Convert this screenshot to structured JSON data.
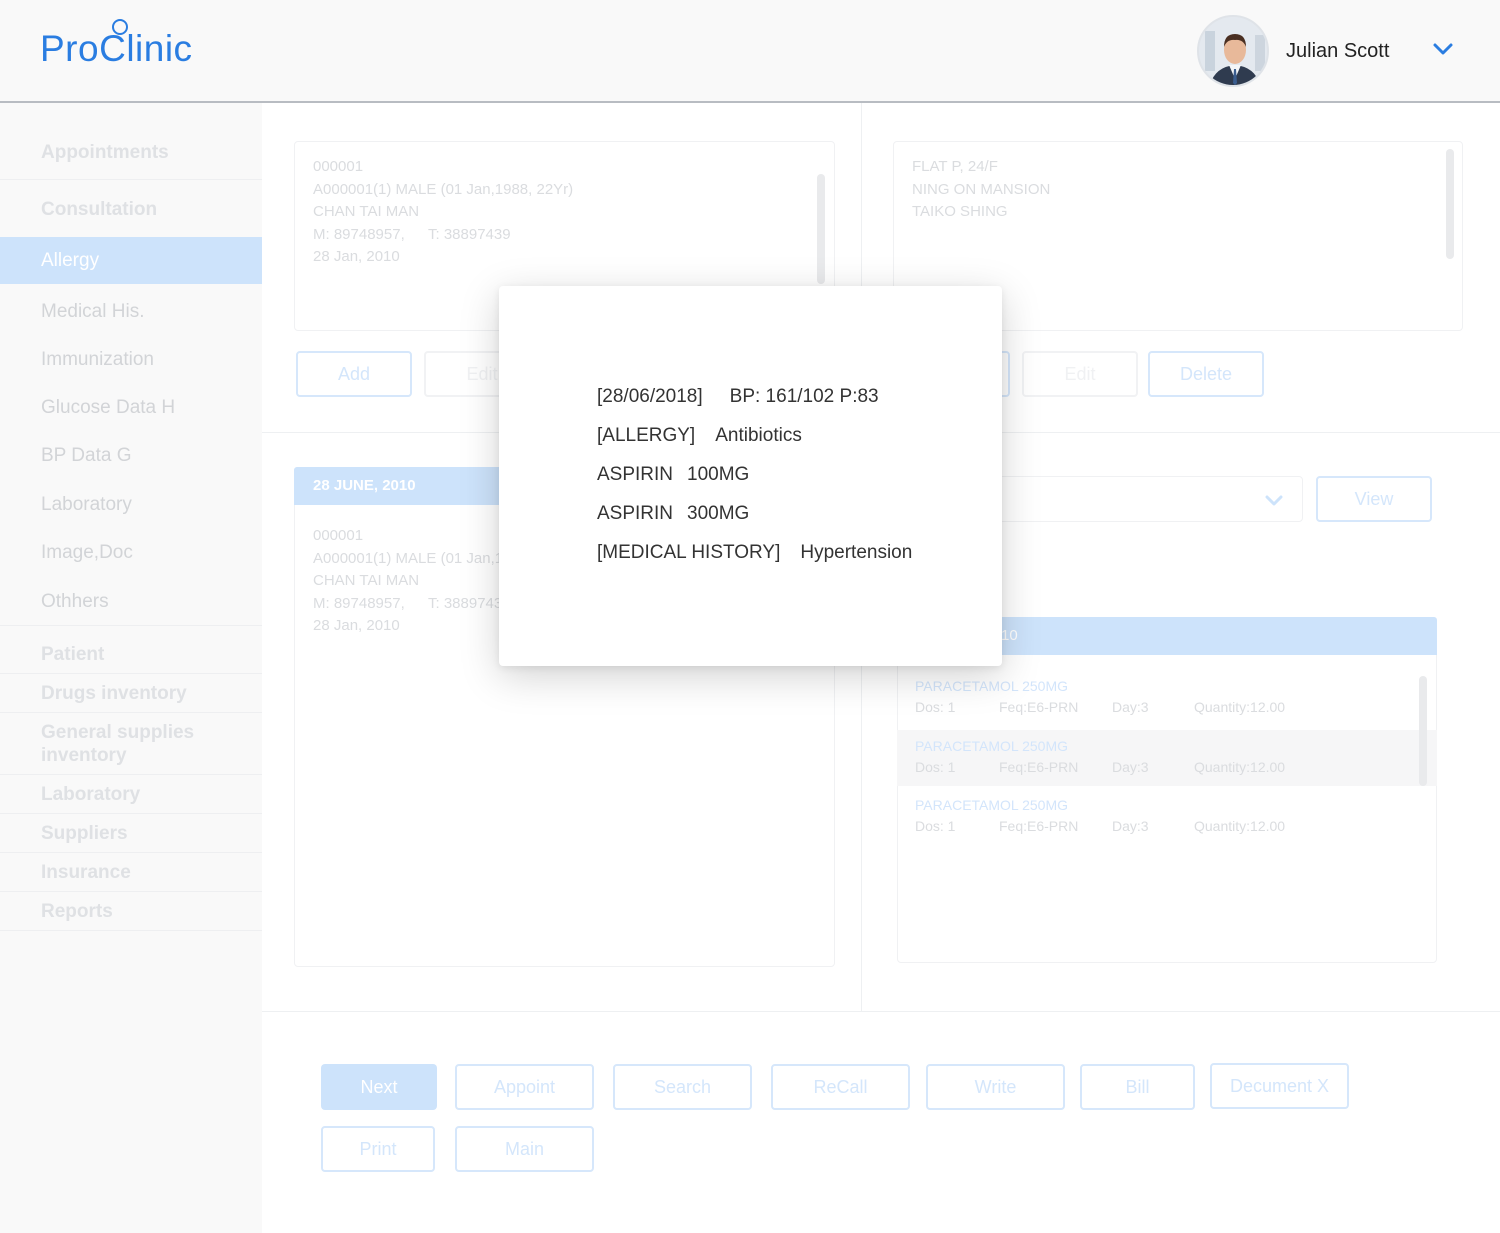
{
  "header": {
    "logo_left": "Pro",
    "logo_right": "linic",
    "user_name": "Julian Scott"
  },
  "sidebar": {
    "items": [
      {
        "label": "Appointments"
      },
      {
        "label": "Consultation"
      },
      {
        "label": "Allergy"
      },
      {
        "label": "Medical His."
      },
      {
        "label": "Immunization"
      },
      {
        "label": "Glucose Data H"
      },
      {
        "label": "BP Data G"
      },
      {
        "label": "Laboratory"
      },
      {
        "label": "Image,Doc"
      },
      {
        "label": "Othhers"
      },
      {
        "label": "Patient"
      },
      {
        "label": "Drugs inventory"
      },
      {
        "label": "General supplies inventory"
      },
      {
        "label": "Laboratory"
      },
      {
        "label": "Suppliers"
      },
      {
        "label": "Insurance"
      },
      {
        "label": "Reports"
      }
    ],
    "active_item": "Allergy"
  },
  "patient_card": {
    "id": "000001",
    "detail": "A000001(1) MALE (01 Jan,1988, 22Yr)",
    "name": "CHAN TAI MAN",
    "mobile": "M: 89748957,",
    "tel": "T: 38897439",
    "date": "28 Jan, 2010"
  },
  "address_card": {
    "line1": "FLAT P, 24/F",
    "line2": "NING ON MANSION",
    "line3": "TAIKO SHING"
  },
  "left_buttons": {
    "add": "Add",
    "edit": "Edit"
  },
  "right_buttons": {
    "edit": "Edit",
    "delete": "Delete"
  },
  "record_card": {
    "header": "28 JUNE, 2010",
    "id": "000001",
    "detail": "A000001(1) MALE (01 Jan,1",
    "name": "CHAN TAI MAN",
    "mobile": "M: 89748957,",
    "tel": "T: 3889743",
    "date": "28 Jan, 2010"
  },
  "view_button": "View",
  "prescription": {
    "header_fragment": "10",
    "items": [
      {
        "name": "PARACETAMOL 250MG",
        "dos": "Dos: 1",
        "freq": "Feq:E6-PRN",
        "day": "Day:3",
        "qty": "Quantity:12.00"
      },
      {
        "name": "PARACETAMOL 250MG",
        "dos": "Dos: 1",
        "freq": "Feq:E6-PRN",
        "day": "Day:3",
        "qty": "Quantity:12.00"
      },
      {
        "name": "PARACETAMOL 250MG",
        "dos": "Dos: 1",
        "freq": "Feq:E6-PRN",
        "day": "Day:3",
        "qty": "Quantity:12.00"
      }
    ]
  },
  "bottom_buttons": {
    "next": "Next",
    "appoint": "Appoint",
    "search": "Search",
    "recall": "ReCall",
    "write": "Write",
    "bill": "Bill",
    "document": "Decument X",
    "print": "Print",
    "main": "Main"
  },
  "modal": {
    "line1_a": "[28/06/2018]",
    "line1_b": "BP: 161/102 P:83",
    "line2_a": "[ALLERGY]",
    "line2_b": "Antibiotics",
    "line3_a": "ASPIRIN",
    "line3_b": "100MG",
    "line4_a": "ASPIRIN",
    "line4_b": "300MG",
    "line5_a": "[MEDICAL HISTORY]",
    "line5_b": "Hypertension"
  },
  "colors": {
    "brand": "#2a7de1",
    "accent_light": "#cde3fb",
    "sidebar_bg": "#f9f9f9"
  }
}
